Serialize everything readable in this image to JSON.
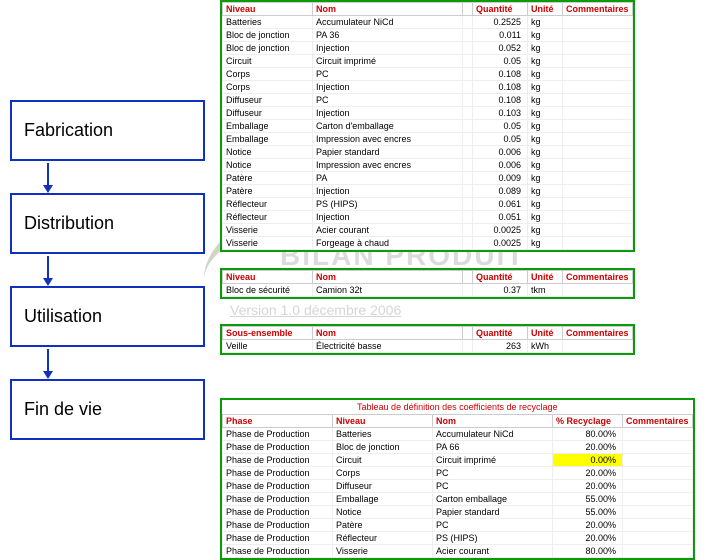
{
  "logo": {
    "title": "BILAN PRODUIT",
    "version": "Version 1.0 décembre 2006",
    "petals": [
      "#e8d050",
      "#d89030",
      "#a0c850",
      "#60a030"
    ]
  },
  "phases": [
    {
      "label": "Fabrication"
    },
    {
      "label": "Distribution"
    },
    {
      "label": "Utilisation"
    },
    {
      "label": "Fin de vie"
    }
  ],
  "fabrication": {
    "headers": [
      "Niveau",
      "Nom",
      "",
      "Quantité",
      "Unité",
      "Commentaires"
    ],
    "rows": [
      [
        "Batteries",
        "Accumulateur NiCd",
        "",
        "0.2525",
        "kg",
        ""
      ],
      [
        "Bloc de jonction",
        "PA 36",
        "",
        "0.011",
        "kg",
        ""
      ],
      [
        "Bloc de jonction",
        "Injection",
        "",
        "0.052",
        "kg",
        ""
      ],
      [
        "Circuit",
        "Circuit imprimé",
        "",
        "0.05",
        "kg",
        ""
      ],
      [
        "Corps",
        "PC",
        "",
        "0.108",
        "kg",
        ""
      ],
      [
        "Corps",
        "Injection",
        "",
        "0.108",
        "kg",
        ""
      ],
      [
        "Diffuseur",
        "PC",
        "",
        "0.108",
        "kg",
        ""
      ],
      [
        "Diffuseur",
        "Injection",
        "",
        "0.103",
        "kg",
        ""
      ],
      [
        "Emballage",
        "Carton d'emballage",
        "",
        "0.05",
        "kg",
        ""
      ],
      [
        "Emballage",
        "Impression avec encres",
        "",
        "0.05",
        "kg",
        ""
      ],
      [
        "Notice",
        "Papier standard",
        "",
        "0.006",
        "kg",
        ""
      ],
      [
        "Notice",
        "Impression avec encres",
        "",
        "0.006",
        "kg",
        ""
      ],
      [
        "Patère",
        "PA",
        "",
        "0.009",
        "kg",
        ""
      ],
      [
        "Patère",
        "Injection",
        "",
        "0.089",
        "kg",
        ""
      ],
      [
        "Réflecteur",
        "PS (HIPS)",
        "",
        "0.061",
        "kg",
        ""
      ],
      [
        "Réflecteur",
        "Injection",
        "",
        "0.051",
        "kg",
        ""
      ],
      [
        "Visserie",
        "Acier courant",
        "",
        "0.0025",
        "kg",
        ""
      ],
      [
        "Visserie",
        "Forgeage à chaud",
        "",
        "0.0025",
        "kg",
        ""
      ]
    ]
  },
  "distribution": {
    "headers": [
      "Niveau",
      "Nom",
      "",
      "Quantité",
      "Unité",
      "Commentaires"
    ],
    "rows": [
      [
        "Bloc de sécurité",
        "Camion 32t",
        "",
        "0.37",
        "tkm",
        ""
      ]
    ]
  },
  "utilisation": {
    "headers": [
      "Sous-ensemble",
      "Nom",
      "",
      "Quantité",
      "Unité",
      "Commentaires"
    ],
    "rows": [
      [
        "Veille",
        "Électricité basse",
        "",
        "263",
        "kWh",
        ""
      ]
    ]
  },
  "findevie": {
    "title": "Tableau de définition des coefficients de recyclage",
    "headers": [
      "Phase",
      "Niveau",
      "Nom",
      "% Recyclage",
      "Commentaires"
    ],
    "rows": [
      [
        "Phase de Production",
        "Batteries",
        "Accumulateur NiCd",
        "80.00%",
        "",
        false
      ],
      [
        "Phase de Production",
        "Bloc de jonction",
        "PA 66",
        "20.00%",
        "",
        false
      ],
      [
        "Phase de Production",
        "Circuit",
        "Circuit imprimé",
        "0.00%",
        "",
        true
      ],
      [
        "Phase de Production",
        "Corps",
        "PC",
        "20.00%",
        "",
        false
      ],
      [
        "Phase de Production",
        "Diffuseur",
        "PC",
        "20.00%",
        "",
        false
      ],
      [
        "Phase de Production",
        "Emballage",
        "Carton emballage",
        "55.00%",
        "",
        false
      ],
      [
        "Phase de Production",
        "Notice",
        "Papier standard",
        "55.00%",
        "",
        false
      ],
      [
        "Phase de Production",
        "Patère",
        "PC",
        "20.00%",
        "",
        false
      ],
      [
        "Phase de Production",
        "Réflecteur",
        "PS (HIPS)",
        "20.00%",
        "",
        false
      ],
      [
        "Phase de Production",
        "Visserie",
        "Acier courant",
        "80.00%",
        "",
        false
      ]
    ]
  }
}
